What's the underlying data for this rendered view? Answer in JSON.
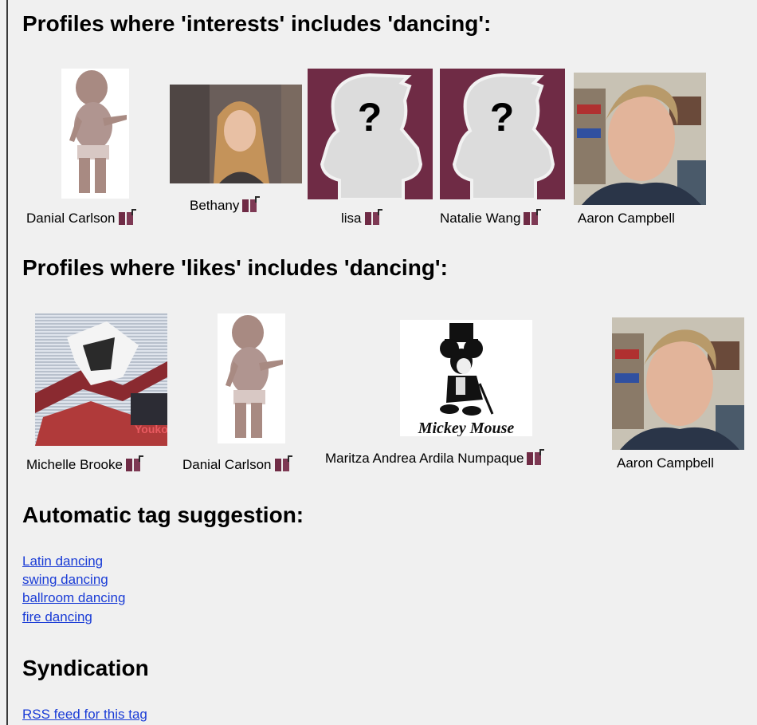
{
  "sections": {
    "interests_heading": "Profiles where 'interests' includes 'dancing':",
    "likes_heading": "Profiles where 'likes' includes 'dancing':",
    "suggestion_heading": "Automatic tag suggestion:",
    "syndication_heading": "Syndication"
  },
  "interests_profiles": [
    {
      "name": "Danial Carlson",
      "photo": "baby-photo"
    },
    {
      "name": "Bethany",
      "photo": "girl-photo"
    },
    {
      "name": "lisa",
      "photo": "no-photo-placeholder"
    },
    {
      "name": "Natalie Wang",
      "photo": "no-photo-placeholder"
    },
    {
      "name": "Aaron Campbell",
      "photo": "man-photo"
    }
  ],
  "likes_profiles": [
    {
      "name": "Michelle Brooke",
      "photo": "anime-photo"
    },
    {
      "name": "Danial Carlson",
      "photo": "baby-photo"
    },
    {
      "name": "Maritza Andrea Ardila Numpaque",
      "photo": "mickey-photo",
      "photo_caption": "Mickey Mouse"
    },
    {
      "name": "Aaron Campbell",
      "photo": "man-photo"
    }
  ],
  "placeholder_mark": "?",
  "anime_caption": "Youko",
  "tag_suggestions": [
    "Latin dancing",
    "swing dancing",
    "ballroom dancing",
    "fire dancing"
  ],
  "syndication_link": "RSS feed for this tag",
  "colors": {
    "background": "#f0f0f0",
    "link": "#1a3cd6",
    "placeholder_bg": "#6f2b45",
    "group_icon": "#6f2b45"
  }
}
